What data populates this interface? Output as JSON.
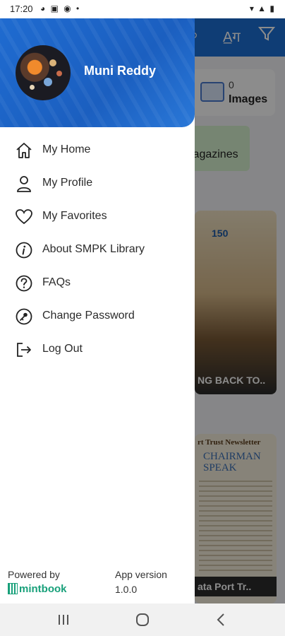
{
  "status_bar": {
    "time": "17:20",
    "left_icons": "◕ ▣ ◉ •",
    "right_icons": "▾ ▲ ▮"
  },
  "background": {
    "images_card": {
      "count": "0",
      "label": "Images"
    },
    "magazines_card": {
      "label": "lagazines"
    },
    "book_1": {
      "caption": "NG BACK TO..",
      "logo_text": "150"
    },
    "book_2": {
      "header": "rt Trust Newsletter",
      "heading": "CHAIRMAN SPEAK",
      "caption": "ata Port Tr.."
    }
  },
  "drawer": {
    "user_name": "Muni Reddy",
    "menu": [
      {
        "label": "My Home",
        "icon": "home-icon"
      },
      {
        "label": "My Profile",
        "icon": "person-icon"
      },
      {
        "label": "My Favorites",
        "icon": "heart-icon"
      },
      {
        "label": "About SMPK Library",
        "icon": "info-icon"
      },
      {
        "label": "FAQs",
        "icon": "question-icon"
      },
      {
        "label": "Change Password",
        "icon": "key-icon"
      },
      {
        "label": "Log Out",
        "icon": "logout-icon"
      }
    ],
    "footer": {
      "powered_by": "Powered by",
      "brand": "mintbook",
      "version_label": "App version",
      "version": "1.0.0"
    }
  },
  "colors": {
    "drawer_header": "#1f6bd0",
    "brand_green": "#18a07a",
    "app_header": "#1d6fd6"
  }
}
